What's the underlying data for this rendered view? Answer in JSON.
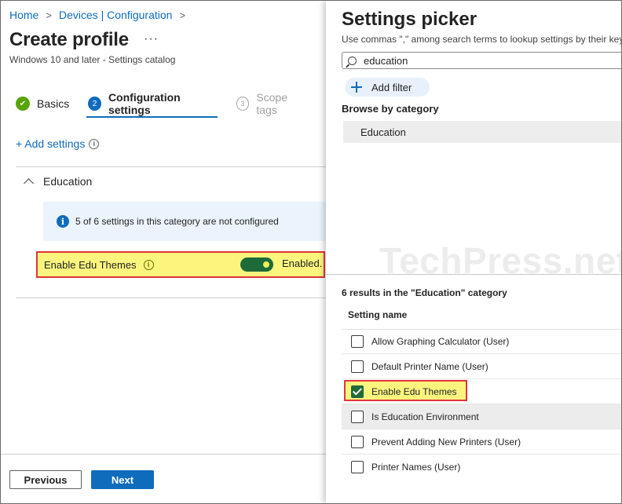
{
  "breadcrumb": [
    "Home",
    "Devices | Configuration"
  ],
  "page": {
    "title": "Create profile",
    "subtitle": "Windows 10 and later - Settings catalog",
    "more": "···"
  },
  "steps": [
    {
      "number": "1",
      "label": "Basics",
      "state": "done"
    },
    {
      "number": "2",
      "label": "Configuration settings",
      "state": "active"
    },
    {
      "number": "3",
      "label": "Scope tags",
      "state": "pending"
    }
  ],
  "add_settings": "+ Add settings",
  "section": {
    "title": "Education",
    "info_text": "5 of 6 settings in this category are not configured",
    "setting": {
      "name": "Enable Edu Themes",
      "state": "Enabled."
    }
  },
  "footer": {
    "previous": "Previous",
    "next": "Next"
  },
  "picker": {
    "title": "Settings picker",
    "description": "Use commas \",\" among search terms to lookup settings by their key",
    "search_value": "education",
    "add_filter": "Add filter",
    "browse_label": "Browse by category",
    "category": "Education",
    "watermark": "TechPress.net",
    "results_label": "6 results in the \"Education\" category",
    "column_header": "Setting name",
    "results": [
      {
        "label": "Allow Graphing Calculator (User)",
        "checked": false
      },
      {
        "label": "Default Printer Name (User)",
        "checked": false
      },
      {
        "label": "Enable Edu Themes",
        "checked": true
      },
      {
        "label": "Is Education Environment",
        "checked": false
      },
      {
        "label": "Prevent Adding New Printers (User)",
        "checked": false
      },
      {
        "label": "Printer Names (User)",
        "checked": false
      }
    ]
  },
  "colors": {
    "accent": "#0f6cbd",
    "success": "#57a300",
    "toggle_on": "#1e6b3a",
    "highlight": "#fbf57e",
    "highlight_border": "#e0343d"
  }
}
